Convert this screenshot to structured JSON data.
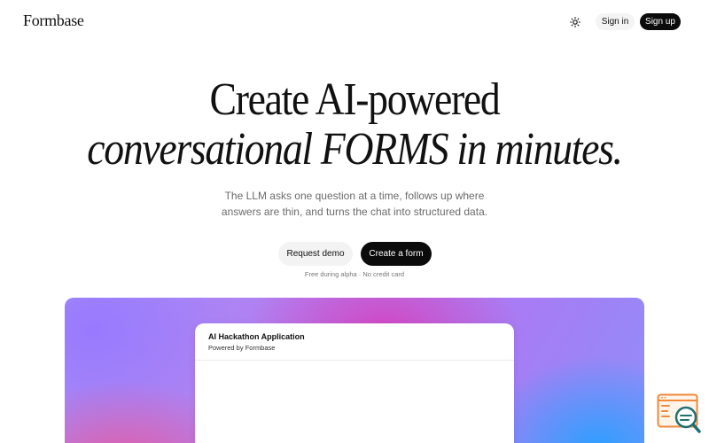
{
  "header": {
    "logo": "Formbase",
    "theme_toggle_icon": "sun-icon",
    "sign_in": "Sign in",
    "sign_up": "Sign up"
  },
  "hero": {
    "line1": "Create AI-powered",
    "line2": "conversational FORMS in minutes.",
    "subtitle_line1": "The LLM asks one question at a time, follows up where",
    "subtitle_line2": "answers are thin, and turns the chat into structured data.",
    "request_demo": "Request demo",
    "create_form": "Create a form",
    "note": "Free during alpha · No credit card"
  },
  "preview": {
    "form_title": "AI Hackathon Application",
    "form_subtitle": "Powered by Formbase"
  },
  "floating_widget": {
    "icon": "search-feedback-icon"
  },
  "colors": {
    "primary_button": "#0b0b0b",
    "secondary_button": "#f3f3f3",
    "gradient_purple": "#a68cf7",
    "gradient_magenta": "#d640bc",
    "gradient_blue": "#28a0ff",
    "widget_orange": "#f08a3c",
    "widget_teal": "#1f6f73"
  }
}
